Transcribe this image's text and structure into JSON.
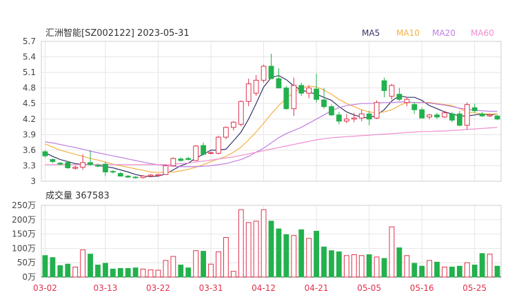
{
  "header": {
    "title": "汇洲智能[SZ002122] 2023-05-31"
  },
  "legend": [
    {
      "label": "MA5",
      "color": "#333366"
    },
    {
      "label": "MA10",
      "color": "#f5b041"
    },
    {
      "label": "MA20",
      "color": "#c07ee0"
    },
    {
      "label": "MA60",
      "color": "#f08ccf"
    }
  ],
  "volume_label": "成交量 367583",
  "colors": {
    "up": "#e0304a",
    "down": "#22b14c",
    "grid": "#e5e5e5",
    "axis": "#444444",
    "date": "#e0304a"
  },
  "chart_data": [
    {
      "type": "candlestick",
      "title": "汇洲智能[SZ002122] 2023-05-31",
      "ylim": [
        3.0,
        5.7
      ],
      "y_ticks": [
        "5.7",
        "5.4",
        "5.1",
        "4.8",
        "4.5",
        "4.2",
        "3.9",
        "3.6",
        "3.3",
        "3"
      ],
      "x_tick_labels": [
        "03-02",
        "03-13",
        "03-22",
        "03-31",
        "04-12",
        "04-21",
        "05-05",
        "05-16",
        "05-25"
      ],
      "x_tick_index": [
        0,
        8,
        15,
        22,
        29,
        36,
        43,
        50,
        57
      ],
      "grid": true,
      "legend_position": "top-right",
      "candles": [
        {
          "date": "03-02",
          "o": 3.57,
          "h": 3.6,
          "l": 3.46,
          "c": 3.49
        },
        {
          "date": "",
          "o": 3.42,
          "h": 3.44,
          "l": 3.35,
          "c": 3.38
        },
        {
          "date": "",
          "o": 3.35,
          "h": 3.37,
          "l": 3.31,
          "c": 3.33
        },
        {
          "date": "",
          "o": 3.36,
          "h": 3.38,
          "l": 3.24,
          "c": 3.26
        },
        {
          "date": "",
          "o": 3.25,
          "h": 3.3,
          "l": 3.22,
          "c": 3.27
        },
        {
          "date": "",
          "o": 3.27,
          "h": 3.52,
          "l": 3.22,
          "c": 3.36
        },
        {
          "date": "",
          "o": 3.36,
          "h": 3.6,
          "l": 3.3,
          "c": 3.32
        },
        {
          "date": "",
          "o": 3.31,
          "h": 3.34,
          "l": 3.27,
          "c": 3.29
        },
        {
          "date": "03-13",
          "o": 3.33,
          "h": 3.38,
          "l": 3.1,
          "c": 3.18
        },
        {
          "date": "",
          "o": 3.19,
          "h": 3.22,
          "l": 3.15,
          "c": 3.18
        },
        {
          "date": "",
          "o": 3.15,
          "h": 3.18,
          "l": 3.09,
          "c": 3.1
        },
        {
          "date": "",
          "o": 3.1,
          "h": 3.12,
          "l": 3.06,
          "c": 3.08
        },
        {
          "date": "",
          "o": 3.08,
          "h": 3.1,
          "l": 3.05,
          "c": 3.07
        },
        {
          "date": "",
          "o": 3.07,
          "h": 3.12,
          "l": 3.05,
          "c": 3.1
        },
        {
          "date": "",
          "o": 3.1,
          "h": 3.14,
          "l": 3.08,
          "c": 3.12
        },
        {
          "date": "03-22",
          "o": 3.11,
          "h": 3.14,
          "l": 3.1,
          "c": 3.13
        },
        {
          "date": "",
          "o": 3.13,
          "h": 3.32,
          "l": 3.12,
          "c": 3.3
        },
        {
          "date": "",
          "o": 3.3,
          "h": 3.46,
          "l": 3.29,
          "c": 3.44
        },
        {
          "date": "",
          "o": 3.43,
          "h": 3.46,
          "l": 3.38,
          "c": 3.4
        },
        {
          "date": "",
          "o": 3.44,
          "h": 3.47,
          "l": 3.4,
          "c": 3.42
        },
        {
          "date": "",
          "o": 3.4,
          "h": 3.7,
          "l": 3.39,
          "c": 3.68
        },
        {
          "date": "",
          "o": 3.69,
          "h": 3.75,
          "l": 3.5,
          "c": 3.52
        },
        {
          "date": "03-31",
          "o": 3.54,
          "h": 3.58,
          "l": 3.52,
          "c": 3.55
        },
        {
          "date": "",
          "o": 3.54,
          "h": 3.88,
          "l": 3.52,
          "c": 3.85
        },
        {
          "date": "",
          "o": 3.85,
          "h": 4.06,
          "l": 3.81,
          "c": 4.04
        },
        {
          "date": "",
          "o": 4.04,
          "h": 4.16,
          "l": 3.98,
          "c": 4.14
        },
        {
          "date": "",
          "o": 4.1,
          "h": 4.56,
          "l": 4.06,
          "c": 4.54
        },
        {
          "date": "",
          "o": 4.54,
          "h": 4.98,
          "l": 4.45,
          "c": 4.88
        },
        {
          "date": "",
          "o": 4.7,
          "h": 5.05,
          "l": 4.65,
          "c": 4.95
        },
        {
          "date": "04-12",
          "o": 4.95,
          "h": 5.25,
          "l": 4.9,
          "c": 5.22
        },
        {
          "date": "",
          "o": 5.22,
          "h": 5.46,
          "l": 5.18,
          "c": 4.98
        },
        {
          "date": "",
          "o": 4.98,
          "h": 5.18,
          "l": 4.8,
          "c": 4.8
        },
        {
          "date": "",
          "o": 4.8,
          "h": 4.84,
          "l": 4.38,
          "c": 4.4
        },
        {
          "date": "",
          "o": 4.4,
          "h": 5.0,
          "l": 4.26,
          "c": 4.85
        },
        {
          "date": "",
          "o": 4.85,
          "h": 4.9,
          "l": 4.65,
          "c": 4.7
        },
        {
          "date": "",
          "o": 4.7,
          "h": 4.85,
          "l": 4.6,
          "c": 4.8
        },
        {
          "date": "04-21",
          "o": 4.78,
          "h": 5.08,
          "l": 4.52,
          "c": 4.58
        },
        {
          "date": "",
          "o": 4.57,
          "h": 4.8,
          "l": 4.4,
          "c": 4.44
        },
        {
          "date": "",
          "o": 4.44,
          "h": 4.48,
          "l": 4.26,
          "c": 4.28
        },
        {
          "date": "",
          "o": 4.28,
          "h": 4.34,
          "l": 4.1,
          "c": 4.16
        },
        {
          "date": "",
          "o": 4.16,
          "h": 4.3,
          "l": 4.12,
          "c": 4.2
        },
        {
          "date": "",
          "o": 4.2,
          "h": 4.32,
          "l": 4.14,
          "c": 4.22
        },
        {
          "date": "",
          "o": 4.22,
          "h": 4.38,
          "l": 4.16,
          "c": 4.3
        },
        {
          "date": "05-05",
          "o": 4.3,
          "h": 4.36,
          "l": 4.08,
          "c": 4.2
        },
        {
          "date": "",
          "o": 4.22,
          "h": 4.56,
          "l": 4.2,
          "c": 4.52
        },
        {
          "date": "",
          "o": 4.94,
          "h": 5.0,
          "l": 4.62,
          "c": 4.75
        },
        {
          "date": "",
          "o": 4.64,
          "h": 4.88,
          "l": 4.58,
          "c": 4.85
        },
        {
          "date": "",
          "o": 4.68,
          "h": 4.8,
          "l": 4.55,
          "c": 4.58
        },
        {
          "date": "",
          "o": 4.52,
          "h": 4.62,
          "l": 4.45,
          "c": 4.58
        },
        {
          "date": "",
          "o": 4.48,
          "h": 4.52,
          "l": 4.3,
          "c": 4.38
        },
        {
          "date": "05-16",
          "o": 4.38,
          "h": 4.42,
          "l": 4.22,
          "c": 4.22
        },
        {
          "date": "",
          "o": 4.24,
          "h": 4.3,
          "l": 4.2,
          "c": 4.28
        },
        {
          "date": "",
          "o": 4.28,
          "h": 4.32,
          "l": 4.2,
          "c": 4.24
        },
        {
          "date": "",
          "o": 4.24,
          "h": 4.36,
          "l": 4.22,
          "c": 4.32
        },
        {
          "date": "",
          "o": 4.3,
          "h": 4.34,
          "l": 4.14,
          "c": 4.18
        },
        {
          "date": "",
          "o": 4.3,
          "h": 4.36,
          "l": 4.06,
          "c": 4.08
        },
        {
          "date": "",
          "o": 4.08,
          "h": 4.52,
          "l": 4.0,
          "c": 4.48
        },
        {
          "date": "05-25",
          "o": 4.42,
          "h": 4.5,
          "l": 4.32,
          "c": 4.36
        },
        {
          "date": "",
          "o": 4.3,
          "h": 4.34,
          "l": 4.24,
          "c": 4.26
        },
        {
          "date": "",
          "o": 4.26,
          "h": 4.3,
          "l": 4.24,
          "c": 4.28
        },
        {
          "date": "",
          "o": 4.26,
          "h": 4.28,
          "l": 4.18,
          "c": 4.2
        }
      ],
      "series": [
        {
          "name": "MA5",
          "color": "#333366",
          "values": [
            3.55,
            3.48,
            3.42,
            3.38,
            3.34,
            3.32,
            3.33,
            3.31,
            3.28,
            3.26,
            3.22,
            3.18,
            3.13,
            3.1,
            3.09,
            3.1,
            3.14,
            3.22,
            3.3,
            3.35,
            3.45,
            3.52,
            3.6,
            3.6,
            3.62,
            3.78,
            3.95,
            4.2,
            4.5,
            4.82,
            5.0,
            5.04,
            4.96,
            4.84,
            4.76,
            4.72,
            4.68,
            4.62,
            4.56,
            4.44,
            4.34,
            4.28,
            4.24,
            4.22,
            4.28,
            4.38,
            4.55,
            4.65,
            4.62,
            4.62,
            4.56,
            4.46,
            4.4,
            4.34,
            4.3,
            4.26,
            4.26,
            4.28,
            4.3,
            4.28,
            4.3
          ]
        },
        {
          "name": "MA10",
          "color": "#f5b041",
          "values": [
            3.72,
            3.66,
            3.6,
            3.56,
            3.52,
            3.48,
            3.44,
            3.41,
            3.37,
            3.33,
            3.3,
            3.27,
            3.24,
            3.21,
            3.18,
            3.17,
            3.17,
            3.18,
            3.2,
            3.23,
            3.27,
            3.32,
            3.38,
            3.43,
            3.48,
            3.56,
            3.66,
            3.8,
            3.95,
            4.12,
            4.3,
            4.46,
            4.6,
            4.72,
            4.8,
            4.84,
            4.82,
            4.76,
            4.68,
            4.58,
            4.5,
            4.44,
            4.38,
            4.34,
            4.32,
            4.34,
            4.38,
            4.46,
            4.52,
            4.52,
            4.52,
            4.52,
            4.5,
            4.48,
            4.46,
            4.4,
            4.34,
            4.32,
            4.3,
            4.3,
            4.3
          ]
        },
        {
          "name": "MA20",
          "color": "#c07ee0",
          "values": [
            3.76,
            3.74,
            3.71,
            3.68,
            3.65,
            3.62,
            3.58,
            3.55,
            3.52,
            3.49,
            3.46,
            3.43,
            3.4,
            3.37,
            3.34,
            3.32,
            3.3,
            3.29,
            3.28,
            3.28,
            3.28,
            3.29,
            3.3,
            3.32,
            3.34,
            3.38,
            3.42,
            3.48,
            3.56,
            3.64,
            3.74,
            3.84,
            3.92,
            3.98,
            4.04,
            4.12,
            4.2,
            4.28,
            4.36,
            4.42,
            4.46,
            4.48,
            4.5,
            4.5,
            4.51,
            4.52,
            4.52,
            4.53,
            4.53,
            4.52,
            4.52,
            4.51,
            4.49,
            4.47,
            4.44,
            4.41,
            4.39,
            4.37,
            4.36,
            4.35,
            4.35
          ]
        },
        {
          "name": "MA60",
          "color": "#f08ccf",
          "values": [
            3.32,
            3.32,
            3.32,
            3.32,
            3.32,
            3.32,
            3.32,
            3.32,
            3.32,
            3.32,
            3.32,
            3.32,
            3.32,
            3.32,
            3.32,
            3.32,
            3.32,
            3.33,
            3.34,
            3.35,
            3.37,
            3.39,
            3.41,
            3.43,
            3.45,
            3.47,
            3.5,
            3.53,
            3.56,
            3.59,
            3.62,
            3.65,
            3.68,
            3.71,
            3.74,
            3.77,
            3.8,
            3.82,
            3.84,
            3.85,
            3.86,
            3.87,
            3.88,
            3.89,
            3.9,
            3.91,
            3.92,
            3.93,
            3.94,
            3.95,
            3.96,
            3.96,
            3.97,
            3.97,
            3.98,
            3.99,
            4.0,
            4.01,
            4.02,
            4.03,
            4.04
          ]
        }
      ]
    },
    {
      "type": "bar",
      "title": "成交量 367583",
      "ylim": [
        0,
        250
      ],
      "y_ticks": [
        "250万",
        "200万",
        "150万",
        "100万",
        "50万",
        "0万"
      ],
      "values": [
        75,
        68,
        40,
        45,
        35,
        95,
        80,
        42,
        48,
        28,
        30,
        30,
        32,
        28,
        25,
        24,
        58,
        72,
        42,
        32,
        92,
        90,
        45,
        88,
        138,
        20,
        235,
        190,
        195,
        235,
        195,
        168,
        148,
        145,
        165,
        135,
        160,
        105,
        92,
        88,
        75,
        78,
        75,
        78,
        70,
        65,
        175,
        102,
        75,
        48,
        38,
        58,
        52,
        35,
        35,
        38,
        50,
        42,
        82,
        80,
        38
      ]
    }
  ]
}
